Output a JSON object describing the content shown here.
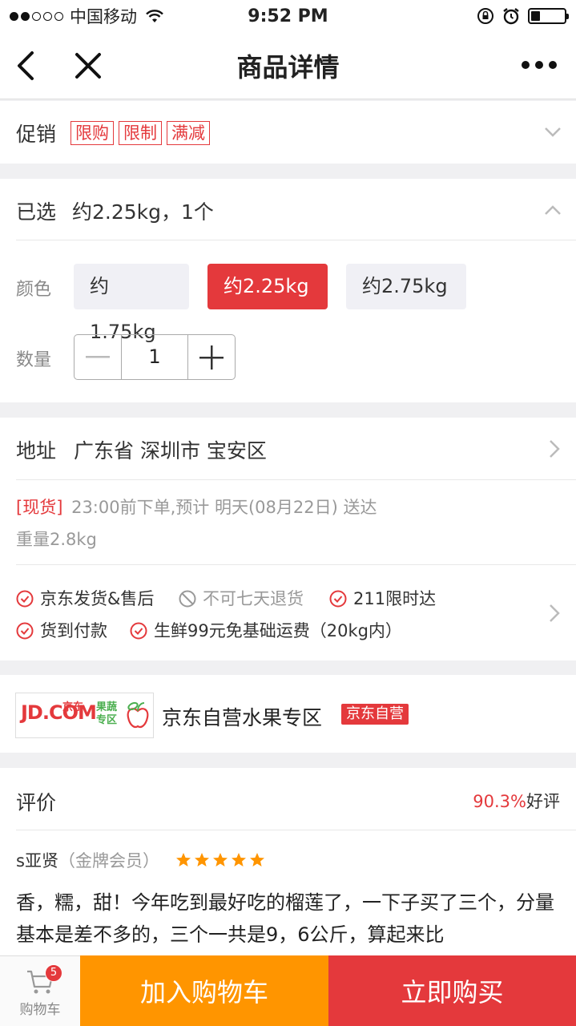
{
  "status_bar": {
    "carrier": "中国移动",
    "time": "9:52 PM"
  },
  "nav": {
    "title": "商品详情"
  },
  "promo": {
    "label": "促销",
    "tags": [
      "限购",
      "限制",
      "满减"
    ]
  },
  "selected": {
    "label": "已选",
    "value": "约2.25kg，1个"
  },
  "color": {
    "label": "颜色",
    "options": [
      "约1.75kg",
      "约2.25kg",
      "约2.75kg"
    ],
    "selected_index": 1
  },
  "quantity": {
    "label": "数量",
    "value": "1"
  },
  "address": {
    "label": "地址",
    "value": "广东省 深圳市 宝安区"
  },
  "delivery": {
    "stock_tag": "[现货]",
    "text": "23:00前下单,预计 明天(08月22日) 送达",
    "weight": "重量2.8kg"
  },
  "services": [
    {
      "text": "京东发货&售后",
      "available": true
    },
    {
      "text": "不可七天退货",
      "available": false
    },
    {
      "text": "211限时达",
      "available": true
    },
    {
      "text": "货到付款",
      "available": true
    },
    {
      "text": "生鲜99元免基础运费（20kg内）",
      "available": true
    }
  ],
  "shop": {
    "logo_text": "JD.COM",
    "logo_sub": "京东",
    "logo_tag": "果蔬专区",
    "name": "京东自营水果专区",
    "badge": "京东自营"
  },
  "reviews": {
    "label": "评价",
    "rate": "90.3%",
    "rate_suffix": "好评",
    "user": "s亚贤",
    "member_level": "（金牌会员）",
    "stars": 5,
    "content": "香，糯，甜！今年吃到最好吃的榴莲了，一下子买了三个，分量基本是差不多的，三个一共是9，6公斤，算起来比"
  },
  "bottom_bar": {
    "cart_label": "购物车",
    "cart_count": "5",
    "add_to_cart": "加入购物车",
    "buy_now": "立即购买"
  },
  "colors": {
    "accent": "#e4393c",
    "orange": "#ff9500",
    "star": "#ff9500"
  }
}
